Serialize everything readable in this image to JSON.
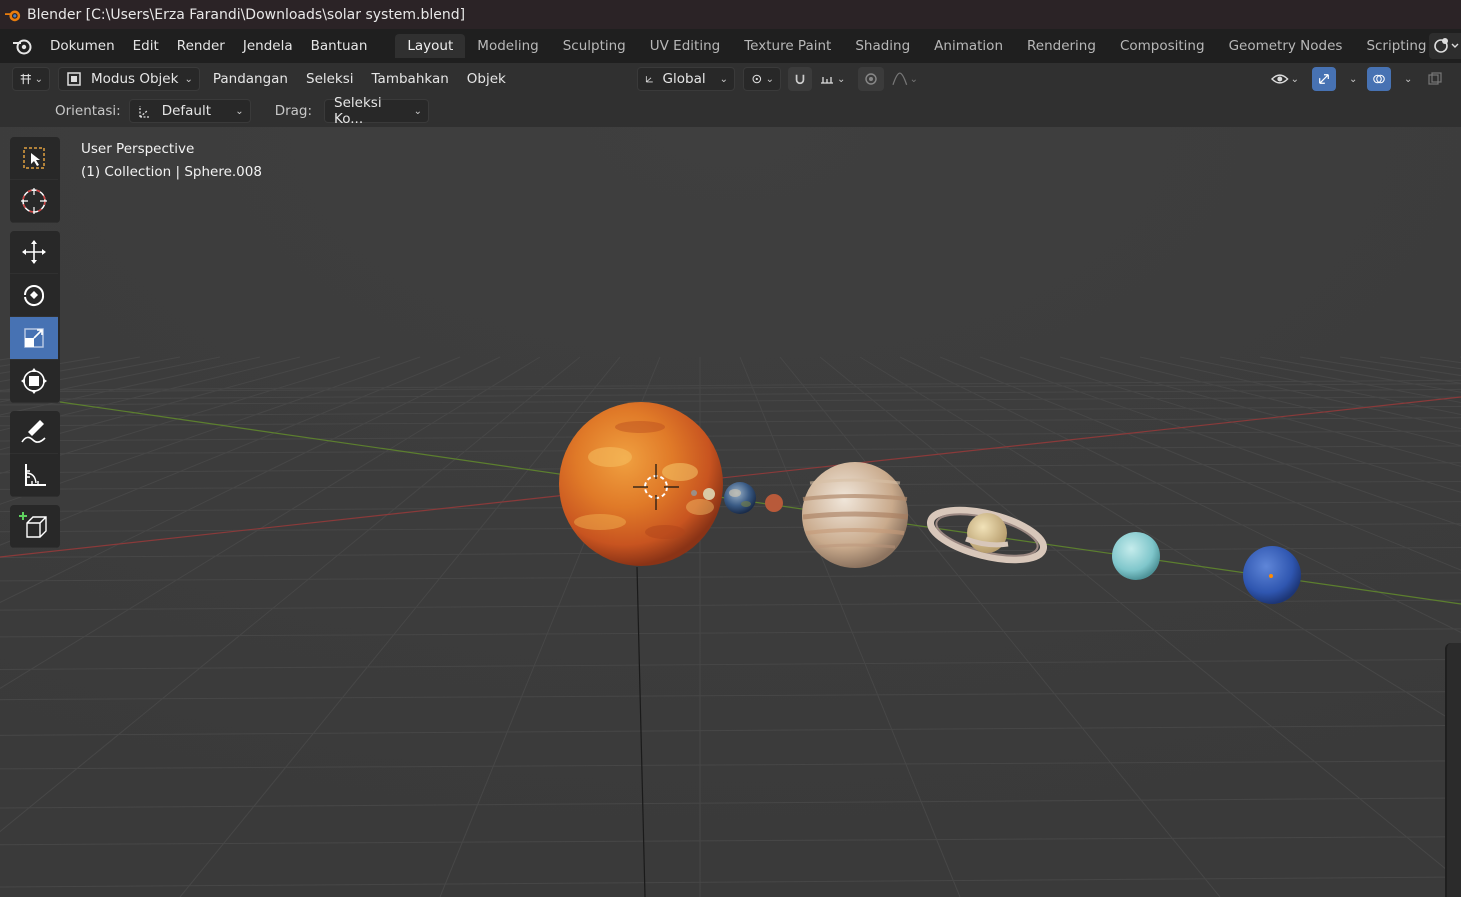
{
  "window": {
    "title": "Blender [C:\\Users\\Erza Farandi\\Downloads\\solar system.blend]"
  },
  "menu": [
    "Dokumen",
    "Edit",
    "Render",
    "Jendela",
    "Bantuan"
  ],
  "workspaces": [
    "Layout",
    "Modeling",
    "Sculpting",
    "UV Editing",
    "Texture Paint",
    "Shading",
    "Animation",
    "Rendering",
    "Compositing",
    "Geometry Nodes",
    "Scripting"
  ],
  "active_workspace": "Layout",
  "header": {
    "mode": "Modus Objek",
    "menus": [
      "Pandangan",
      "Seleksi",
      "Tambahkan",
      "Objek"
    ],
    "transform_orientation": "Global"
  },
  "tool_settings": {
    "orientation_label": "Orientasi:",
    "orientation_value": "Default",
    "drag_label": "Drag:",
    "drag_value": "Seleksi Ko..."
  },
  "viewport": {
    "perspective": "User Perspective",
    "collection": "(1) Collection | Sphere.008"
  },
  "tools": [
    "select-box",
    "cursor",
    "move",
    "rotate",
    "scale",
    "transform",
    "annotate",
    "measure",
    "add-cube"
  ],
  "active_tool": "scale",
  "planets": [
    "sun",
    "mercury",
    "venus",
    "earth",
    "mars",
    "jupiter",
    "saturn",
    "uranus",
    "neptune"
  ],
  "colors": {
    "accent": "#4772b3",
    "x_axis": "#8a3a3a",
    "y_axis": "#5c7f2e"
  }
}
